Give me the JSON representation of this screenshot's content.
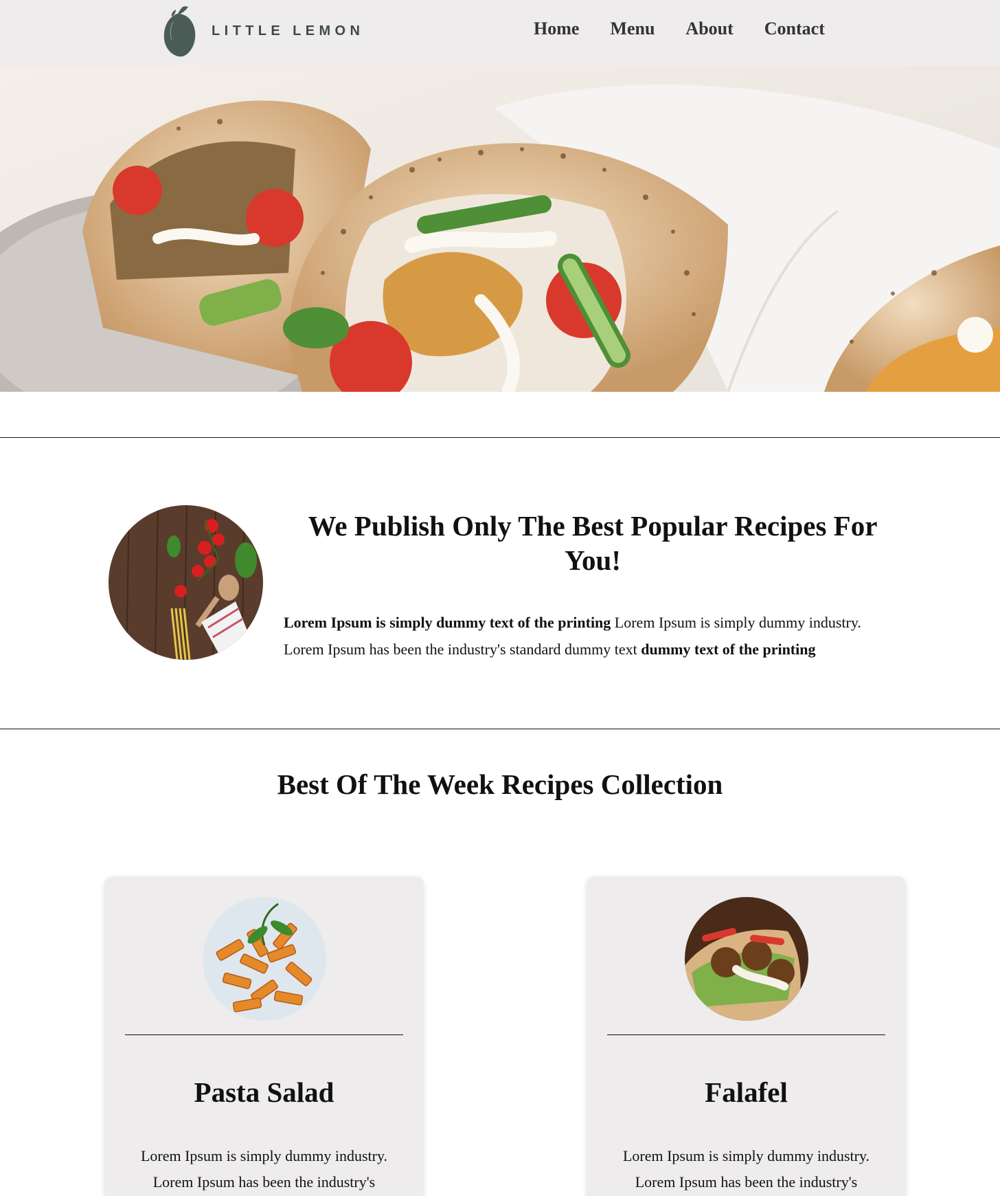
{
  "header": {
    "brand": "LITTLE LEMON",
    "nav": [
      "Home",
      "Menu",
      "About",
      "Contact"
    ]
  },
  "colors": {
    "header_bg": "#eeeced",
    "logo_green": "#4a5c55",
    "card_bg": "#eeeced"
  },
  "intro": {
    "title": "We Publish Only The Best Popular Recipes For You!",
    "body_bold_1": "Lorem Ipsum is simply dummy text of the printing",
    "body_regular": " Lorem Ipsum is simply dummy industry. Lorem Ipsum has been the industry's standard dummy text ",
    "body_bold_2": "dummy text of the printing"
  },
  "collection": {
    "title": "Best Of The Week Recipes Collection",
    "cards": [
      {
        "title": "Pasta Salad",
        "text": "Lorem Ipsum is simply dummy industry. Lorem Ipsum has been the industry's"
      },
      {
        "title": "Falafel",
        "text": "Lorem Ipsum is simply dummy industry. Lorem Ipsum has been the industry's"
      }
    ]
  },
  "icons": {
    "logo": "lemon-icon"
  }
}
